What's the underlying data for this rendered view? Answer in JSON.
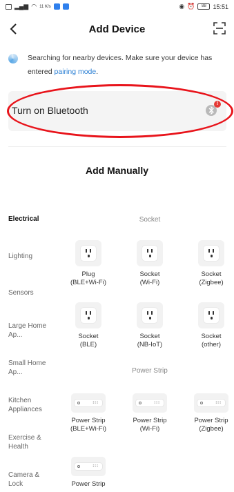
{
  "status_bar": {
    "speed": "11 K/s",
    "battery": "88",
    "time": "15:51"
  },
  "header": {
    "title": "Add Device"
  },
  "notice": {
    "text": "Searching for nearby devices. Make sure your device has entered ",
    "link": "pairing mode",
    "suffix": "."
  },
  "bluetooth": {
    "label": "Turn on Bluetooth",
    "badge": "!"
  },
  "manual": {
    "title": "Add Manually"
  },
  "categories": [
    "Electrical",
    "Lighting",
    "Sensors",
    "Large Home Ap...",
    "Small Home Ap...",
    "Kitchen Appliances",
    "Exercise & Health",
    "Camera & Lock"
  ],
  "sections": [
    {
      "title": "Socket"
    },
    {
      "title": "Power Strip"
    }
  ],
  "socket_items": [
    {
      "name": "Plug",
      "sub": "(BLE+Wi-Fi)"
    },
    {
      "name": "Socket",
      "sub": "(Wi-Fi)"
    },
    {
      "name": "Socket",
      "sub": "(Zigbee)"
    },
    {
      "name": "Socket",
      "sub": "(BLE)"
    },
    {
      "name": "Socket",
      "sub": "(NB-IoT)"
    },
    {
      "name": "Socket",
      "sub": "(other)"
    }
  ],
  "strip_items": [
    {
      "name": "Power Strip",
      "sub": "(BLE+Wi-Fi)"
    },
    {
      "name": "Power Strip",
      "sub": "(Wi-Fi)"
    },
    {
      "name": "Power Strip",
      "sub": "(Zigbee)"
    },
    {
      "name": "Power Strip",
      "sub": ""
    }
  ],
  "colors": {
    "link": "#2a7fd4",
    "highlight": "#e8141b",
    "badge": "#e53935"
  }
}
